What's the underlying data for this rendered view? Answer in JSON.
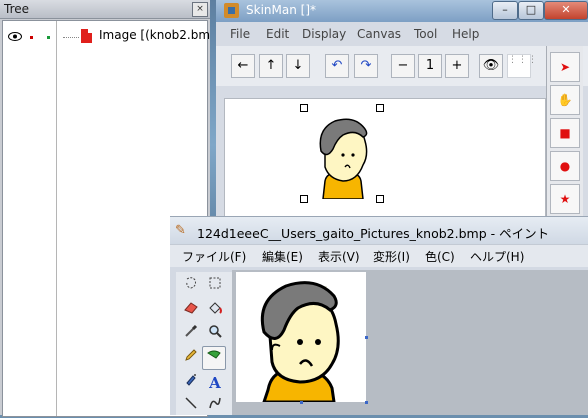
{
  "tree": {
    "title": "Tree",
    "close": "×",
    "item": "Image [(knob2.bm"
  },
  "skinman": {
    "title": "SkinMan []*",
    "controls": {
      "min": "–",
      "max": "□",
      "close": "✕"
    },
    "menu": [
      "File",
      "Edit",
      "Display",
      "Canvas",
      "Tool",
      "Help"
    ],
    "toolbar": {
      "left": "←",
      "up": "↑",
      "down": "↓",
      "undo": "↶",
      "redo": "↷",
      "zoom_out": "−",
      "zoom_fit": "1",
      "zoom_in": "+",
      "eye": "👁",
      "grid": "⋮⋮⋮"
    },
    "side_tools": [
      "➤",
      "✋",
      "■",
      "●",
      "★"
    ]
  },
  "paint": {
    "title": "124d1eeeC__Users_gaito_Pictures_knob2.bmp - ペイント",
    "menu": [
      "ファイル(F)",
      "編集(E)",
      "表示(V)",
      "変形(I)",
      "色(C)",
      "ヘルプ(H)"
    ]
  },
  "colors": {
    "skin": "#fef6c3",
    "hair": "#7a7a7a",
    "shirt": "#f7b500",
    "red_tool": "#e01010"
  },
  "icons": {
    "eye": "eye-icon",
    "doc": "image-doc-icon",
    "select_free": "free-select-icon",
    "select_rect": "rect-select-icon",
    "eraser": "eraser-icon",
    "fill": "fill-icon",
    "picker": "color-picker-icon",
    "zoom": "magnifier-icon",
    "pencil": "pencil-icon",
    "brush": "brush-icon",
    "spray": "airbrush-icon",
    "text": "text-icon",
    "line": "line-icon",
    "curve": "curve-icon"
  }
}
